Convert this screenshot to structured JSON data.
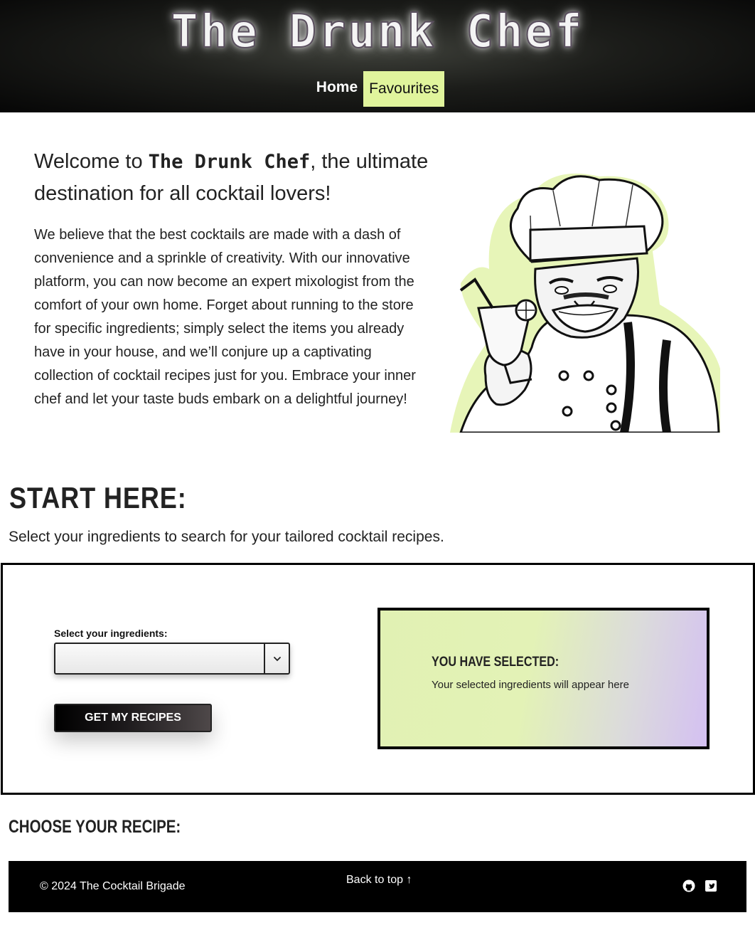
{
  "header": {
    "site_title": "The Drunk Chef",
    "nav": [
      {
        "label": "Home",
        "active": false
      },
      {
        "label": "Favourites",
        "active": true
      }
    ],
    "active_color": "#e0f49c"
  },
  "intro": {
    "heading_prefix": "Welcome to ",
    "heading_brand": "The Drunk Chef",
    "heading_suffix": ", the ultimate destination for all cocktail lovers!",
    "body": "We believe that the best cocktails are made with a dash of convenience and a sprinkle of creativity. With our innovative platform, you can now become an expert mixologist from the comfort of your own home. Forget about running to the store for specific ingredients; simply select the items you already have in your house, and we’ll conjure up a captivating collection of cocktail recipes just for you. Embrace your inner chef and let your taste buds embark on a delightful journey!",
    "image_icon": "chef-with-cocktail-illustration"
  },
  "start": {
    "title": "START HERE:",
    "subtitle": "Select your ingredients to search for your tailored cocktail recipes."
  },
  "search": {
    "label": "Select your ingredients:",
    "select_value": "",
    "button_label": "GET MY RECIPES"
  },
  "selected": {
    "title": "YOU HAVE SELECTED:",
    "placeholder": "Your selected ingredients will appear here"
  },
  "recipes": {
    "title": "CHOOSE YOUR RECIPE:"
  },
  "footer": {
    "copyright": "© 2024 The Cocktail Brigade",
    "back_to_top": "Back to top ↑",
    "icons": [
      "github-icon",
      "twitter-icon"
    ]
  }
}
